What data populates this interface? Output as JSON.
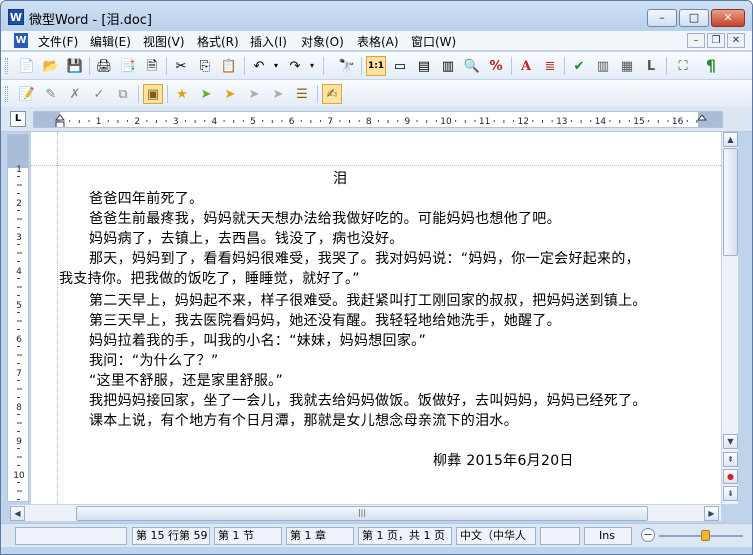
{
  "window": {
    "title": "微型Word - [泪.doc]",
    "app_icon_letter": "W",
    "minimize": "–",
    "maximize": "□",
    "close": "✕"
  },
  "menu": {
    "doc_icon_letter": "W",
    "items": [
      "文件(F)",
      "编辑(E)",
      "视图(V)",
      "格式(R)",
      "插入(I)",
      "对象(O)",
      "表格(A)",
      "窗口(W)"
    ],
    "mdi": {
      "minimize": "–",
      "restore": "❐",
      "close": "✕"
    }
  },
  "toolbar1": {
    "icons": [
      {
        "name": "new-document-icon",
        "glyph": "📄"
      },
      {
        "name": "open-folder-icon",
        "glyph": "📂"
      },
      {
        "name": "save-icon",
        "glyph": "💾"
      },
      {
        "name": "print-icon",
        "glyph": "🖨"
      },
      {
        "name": "print-preview-icon",
        "glyph": "📑"
      },
      {
        "name": "export-icon",
        "glyph": "🗎"
      },
      {
        "name": "cut-icon",
        "glyph": "✂"
      },
      {
        "name": "copy-icon",
        "glyph": "⎘"
      },
      {
        "name": "paste-icon",
        "glyph": "📋"
      },
      {
        "name": "undo-icon",
        "glyph": "↶"
      },
      {
        "name": "undo-dropdown-icon",
        "glyph": "▾"
      },
      {
        "name": "redo-icon",
        "glyph": "↷"
      },
      {
        "name": "redo-dropdown-icon",
        "glyph": "▾"
      },
      {
        "name": "find-icon",
        "glyph": "🔭"
      },
      {
        "name": "actual-size-icon",
        "glyph": "1:1"
      },
      {
        "name": "page-width-icon",
        "glyph": "▭"
      },
      {
        "name": "single-page-icon",
        "glyph": "▤"
      },
      {
        "name": "two-pages-icon",
        "glyph": "▥"
      },
      {
        "name": "zoom-icon",
        "glyph": "🔍"
      },
      {
        "name": "zoom-percent-icon",
        "glyph": "%"
      },
      {
        "name": "text-format-icon",
        "glyph": "A"
      },
      {
        "name": "paragraph-format-icon",
        "glyph": "≣"
      },
      {
        "name": "spell-check-icon",
        "glyph": "✔"
      },
      {
        "name": "columns-icon",
        "glyph": "▥"
      },
      {
        "name": "page-layout-icon",
        "glyph": "▦"
      },
      {
        "name": "header-footer-icon",
        "glyph": "L"
      },
      {
        "name": "binoculars-icon",
        "glyph": "⛶"
      },
      {
        "name": "paragraph-mark-icon",
        "glyph": "¶"
      }
    ]
  },
  "toolbar2": {
    "icons": [
      {
        "name": "edit-document-icon",
        "glyph": "📝"
      },
      {
        "name": "track-changes-icon",
        "glyph": "✎"
      },
      {
        "name": "reject-change-icon",
        "glyph": "✗"
      },
      {
        "name": "accept-change-icon",
        "glyph": "✓"
      },
      {
        "name": "copy-page-icon",
        "glyph": "⧉"
      },
      {
        "name": "review-pane-icon",
        "glyph": "▣"
      },
      {
        "name": "add-comment-icon",
        "glyph": "★"
      },
      {
        "name": "next-comment-icon",
        "glyph": "➤"
      },
      {
        "name": "prev-comment-icon",
        "glyph": "➤"
      },
      {
        "name": "delete-comment-icon",
        "glyph": "➤"
      },
      {
        "name": "show-comments-icon",
        "glyph": "➤"
      },
      {
        "name": "comment-list-icon",
        "glyph": "☰"
      },
      {
        "name": "review-edit-icon",
        "glyph": "✍"
      }
    ]
  },
  "ruler": {
    "corner": "L",
    "marks": [
      "1",
      "2",
      "3",
      "4",
      "5",
      "6",
      "7",
      "8",
      "9",
      "10",
      "11",
      "12",
      "13",
      "14",
      "15",
      "16"
    ]
  },
  "vruler": {
    "marks": [
      "1",
      "2",
      "3",
      "4",
      "5",
      "6",
      "7",
      "8",
      "9",
      "10"
    ]
  },
  "document": {
    "title": "泪",
    "lines": [
      "爸爸四年前死了。",
      "爸爸生前最疼我，妈妈就天天想办法给我做好吃的。可能妈妈也想他了吧。",
      "妈妈病了，去镇上，去西昌。钱没了，病也没好。",
      "那天，妈妈到了，看看妈妈很难受，我哭了。我对妈妈说：“妈妈，你一定会好起来的，",
      "我支持你。把我做的饭吃了，睡睡觉，就好了。”",
      "第二天早上，妈妈起不来，样子很难受。我赶紧叫打工刚回家的叔叔，把妈妈送到镇上。",
      "第三天早上，我去医院看妈妈，她还没有醒。我轻轻地给她洗手，她醒了。",
      "妈妈拉着我的手，叫我的小名：“妹妹，妈妈想回家。”",
      "我问：“为什么了？”",
      "“这里不舒服，还是家里舒服。”",
      "我把妈妈接回家，坐了一会儿，我就去给妈妈做饭。饭做好，去叫妈妈，妈妈已经死了。",
      "课本上说，有个地方有个日月潭，那就是女儿想念母亲流下的泪水。"
    ],
    "signature": "柳彝  2015年6月20日"
  },
  "scrollbar": {
    "up": "▲",
    "down": "▼",
    "prev_page": "⇞",
    "browse": "●",
    "next_page": "⇟",
    "left": "◀",
    "right": "▶",
    "grip": "|||"
  },
  "status": {
    "position": "第 15 行第 59",
    "section": "第 1 节",
    "chapter": "第 1 章",
    "page": "第 1 页，共 1 页",
    "language": "中文（中华人",
    "mode": "Ins",
    "zoom_minus": "−",
    "zoom_level": 0.55
  }
}
